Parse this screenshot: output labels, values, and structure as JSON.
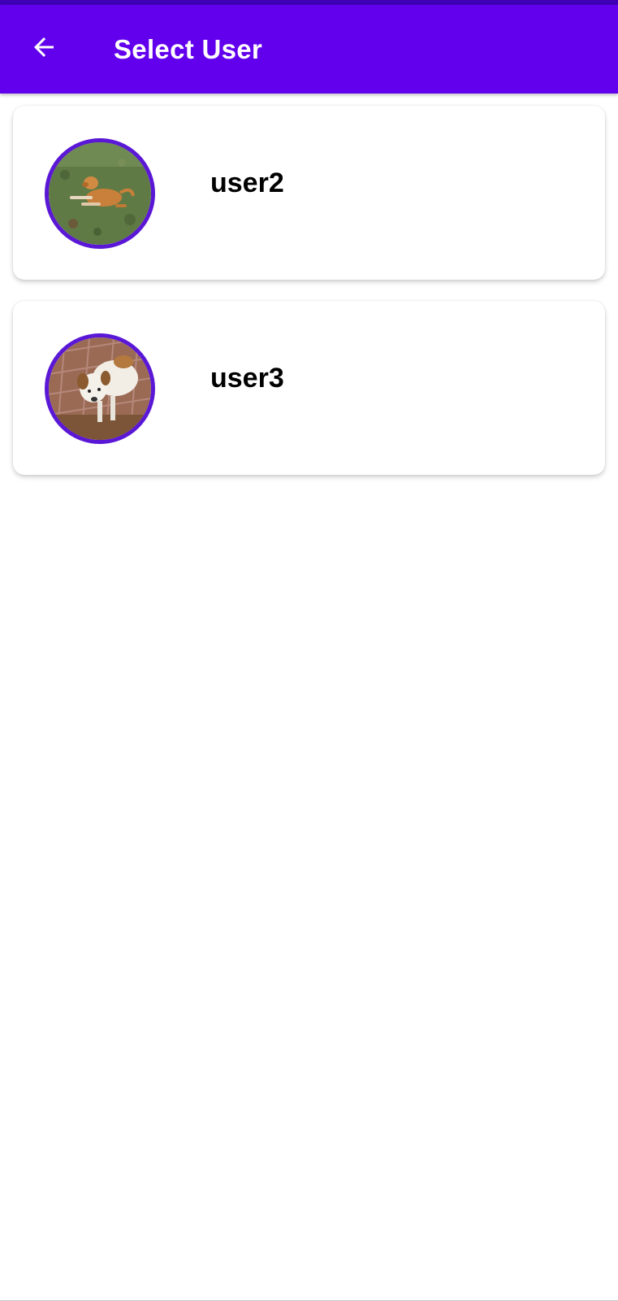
{
  "app_bar": {
    "title": "Select User",
    "back_icon": "arrow-left-icon",
    "background": "#6200ee"
  },
  "users": [
    {
      "name": "user2",
      "avatar": "dog-on-grass-photo"
    },
    {
      "name": "user3",
      "avatar": "dog-on-bricks-photo"
    }
  ],
  "colors": {
    "accent": "#6200ee",
    "avatar_ring": "#5a17d6"
  }
}
